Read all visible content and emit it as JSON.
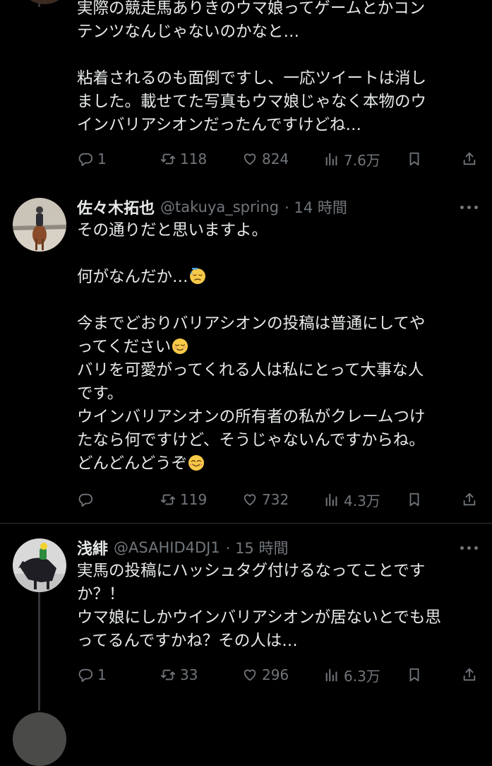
{
  "tweet1": {
    "text": "実際の競走馬ありきのウマ娘ってゲームとかコン\nテンツなんじゃないのかなと…\n\n粘着されるのも面倒ですし、一応ツイートは消し\nました。載せてた写真もウマ娘じゃなく本物のウ\nインバリアシオンだったんですけどね…",
    "replies": "1",
    "retweets": "118",
    "likes": "824",
    "views": "7.6万"
  },
  "tweet2": {
    "name": "佐々木拓也",
    "handle": "@takuya_spring",
    "time": "· 14 時間",
    "line1": "その通りだと思いますよ。",
    "line2": "何がなんだか…",
    "line3a": "今までどおりバリアシオンの投稿は普通にしてや\nってください",
    "line3b": "バリを可愛がってくれる人は私にとって大事な人\nです。\nウインバリアシオンの所有者の私がクレームつけ\nたなら何ですけど、そうじゃないんですからね。\nどんどんどうぞ",
    "replies": "",
    "retweets": "119",
    "likes": "732",
    "views": "4.3万"
  },
  "tweet3": {
    "name": "浅緋",
    "handle": "@ASAHID4DJ1",
    "time": "· 15 時間",
    "text": "実馬の投稿にハッシュタグ付けるなってことです\nか？！\nウマ娘にしかウインバリアシオンが居ないとでも思\nってるんですかね？その人は…",
    "replies": "1",
    "retweets": "33",
    "likes": "296",
    "views": "6.3万"
  },
  "icons": {
    "reply": "reply-icon",
    "retweet": "retweet-icon",
    "like": "heart-icon",
    "views": "views-chart-icon",
    "bookmark": "bookmark-icon",
    "share": "share-icon",
    "emoji_sweat": "downcast-face-with-sweat-emoji",
    "emoji_relieved": "relieved-face-emoji",
    "emoji_smile": "smiling-face-emoji"
  },
  "colors": {
    "background": "#000000",
    "text": "#e7e9ea",
    "secondary": "#71767b",
    "divider": "#2f3336"
  }
}
